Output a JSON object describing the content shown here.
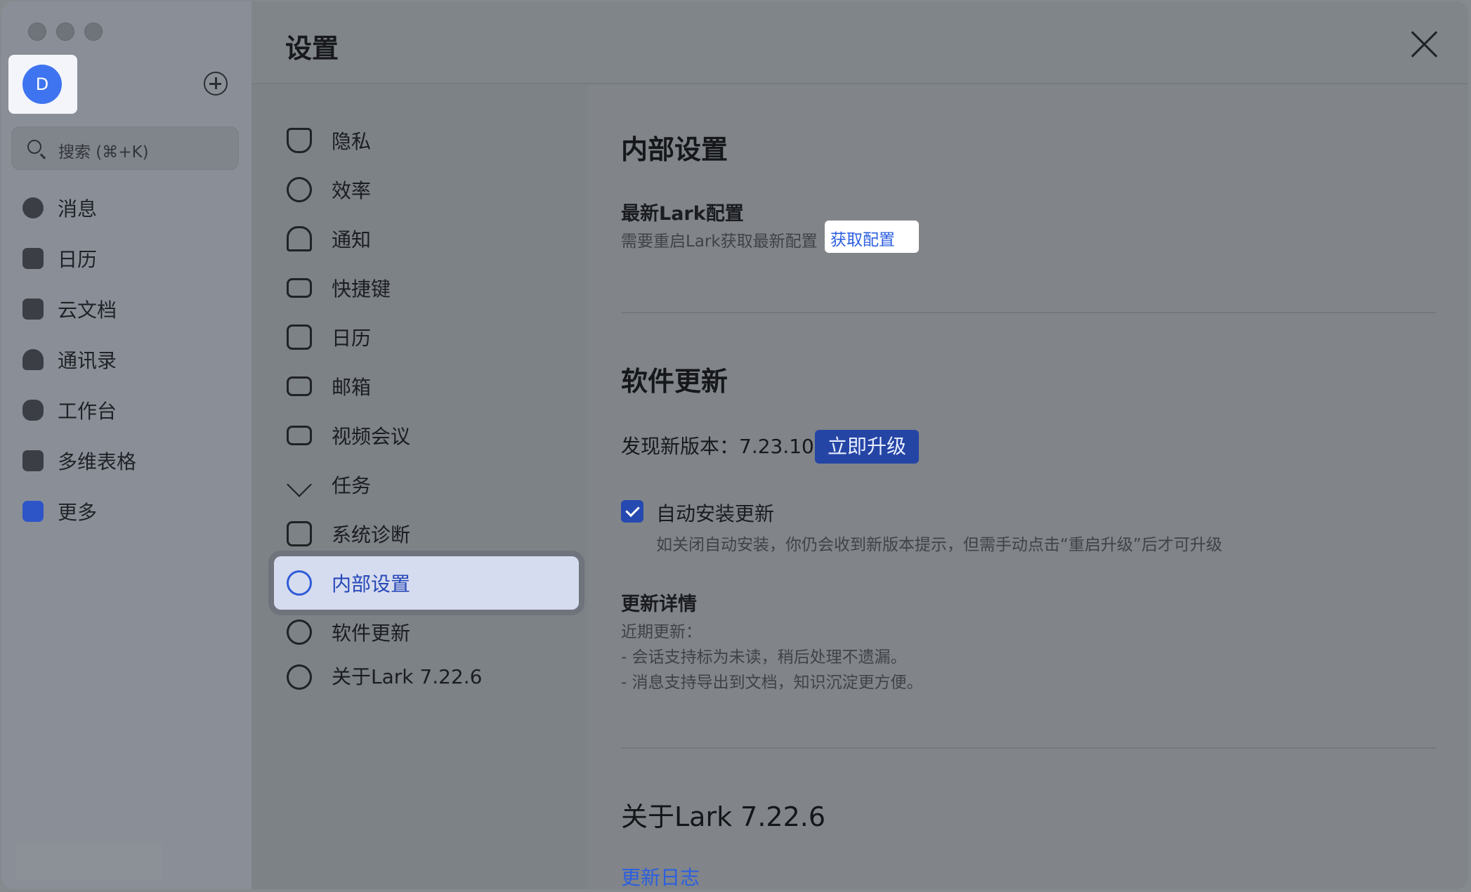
{
  "sidebar": {
    "avatar_initial": "D",
    "search_placeholder": "搜索 (⌘+K)",
    "items": [
      {
        "label": "消息",
        "icon": "chat-icon"
      },
      {
        "label": "日历",
        "icon": "calendar-icon"
      },
      {
        "label": "云文档",
        "icon": "docs-icon"
      },
      {
        "label": "通讯录",
        "icon": "contacts-icon"
      },
      {
        "label": "工作台",
        "icon": "workplace-icon"
      },
      {
        "label": "多维表格",
        "icon": "base-icon"
      },
      {
        "label": "更多",
        "icon": "more-apps-icon"
      }
    ]
  },
  "settings": {
    "title": "设置",
    "menu": [
      {
        "label": "隐私",
        "icon": "shield-icon"
      },
      {
        "label": "效率",
        "icon": "lightbulb-icon"
      },
      {
        "label": "通知",
        "icon": "bell-icon"
      },
      {
        "label": "快捷键",
        "icon": "keyboard-icon"
      },
      {
        "label": "日历",
        "icon": "calendar-icon"
      },
      {
        "label": "邮箱",
        "icon": "mail-icon"
      },
      {
        "label": "视频会议",
        "icon": "video-icon"
      },
      {
        "label": "任务",
        "icon": "task-icon"
      },
      {
        "label": "系统诊断",
        "icon": "diagnostic-icon"
      },
      {
        "label": "内部设置",
        "icon": "wrench-icon",
        "active": true
      },
      {
        "label": "软件更新",
        "icon": "upgrade-icon"
      },
      {
        "label": "关于Lark 7.22.6",
        "icon": "info-icon"
      }
    ],
    "content": {
      "internal_title": "内部设置",
      "latest_config_title": "最新Lark配置",
      "latest_config_desc": "需要重启Lark获取最新配置",
      "get_config_link": "获取配置",
      "update_title": "软件更新",
      "new_version_label": "发现新版本：7.23.10",
      "upgrade_button": "立即升级",
      "auto_install_label": "自动安装更新",
      "auto_install_desc": "如关闭自动安装，你仍会收到新版本提示，但需手动点击“重启升级”后才可升级",
      "details_title": "更新详情",
      "details_recent": "近期更新：",
      "details_item_1": "- 会话支持标为未读，稍后处理不遗漏。",
      "details_item_2": "- 消息支持导出到文档，知识沉淀更方便。",
      "about_title": "关于Lark 7.22.6",
      "changelog_link": "更新日志"
    }
  },
  "colors": {
    "accent": "#2c5fe0",
    "upgrade_bg": "#2545a5",
    "active_bg": "#d6dcef"
  }
}
